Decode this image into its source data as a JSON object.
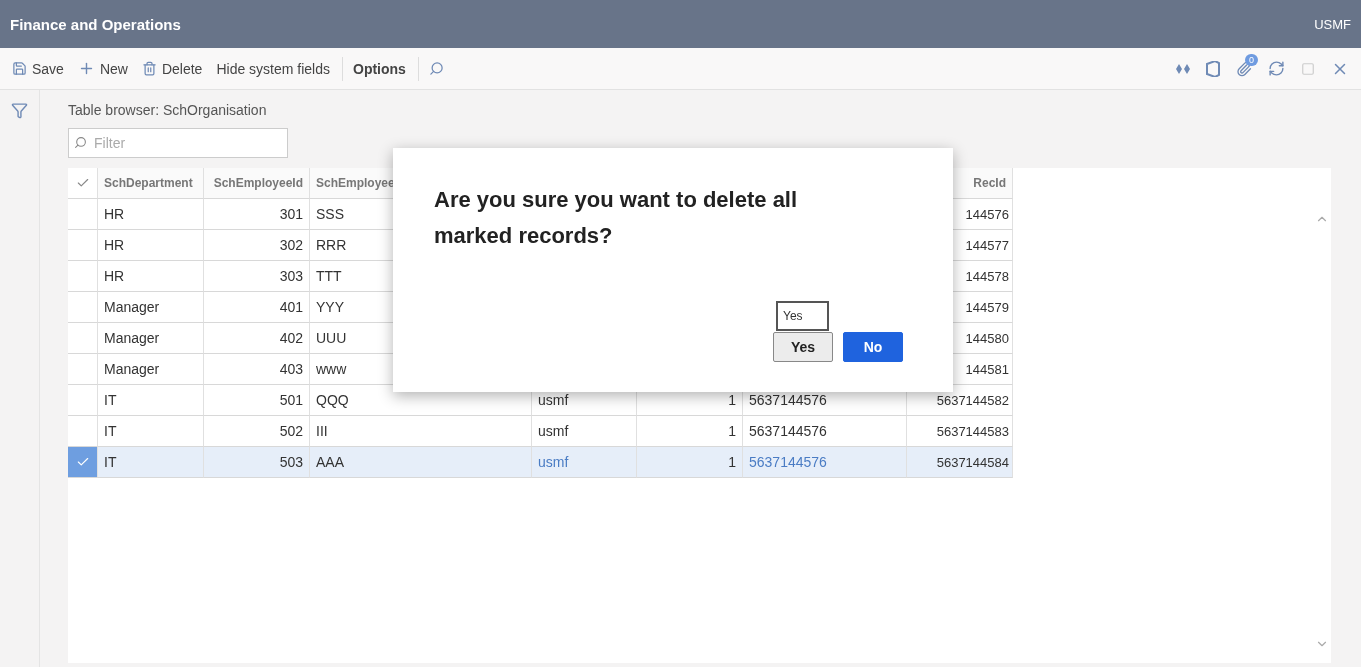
{
  "window": {
    "title": "Finance and Operations",
    "company": "USMF"
  },
  "toolbar": {
    "actions": [
      {
        "kind": "save",
        "label": "Save"
      },
      {
        "kind": "new",
        "label": "New"
      },
      {
        "kind": "delete",
        "label": "Delete"
      },
      {
        "kind": "plain",
        "label": "Hide system fields"
      },
      {
        "kind": "options",
        "label": "Options"
      },
      {
        "kind": "search"
      }
    ],
    "attachment_count": "0"
  },
  "page": {
    "caption": "Table browser: SchOrganisation",
    "filter": {
      "placeholder": "Filter"
    }
  },
  "table": {
    "select_all_checked": false,
    "columns": [
      "SchDepartment",
      "SchEmployeeId",
      "SchEmployee",
      "RecId"
    ],
    "rows": [
      {
        "selected": false,
        "department": "HR",
        "employee_id": "301",
        "employee_name": "SSS",
        "rec_id": "144576"
      },
      {
        "selected": false,
        "department": "HR",
        "employee_id": "302",
        "employee_name": "RRR",
        "rec_id": "144577"
      },
      {
        "selected": false,
        "department": "HR",
        "employee_id": "303",
        "employee_name": "TTT",
        "rec_id": "144578"
      },
      {
        "selected": false,
        "department": "Manager",
        "employee_id": "401",
        "employee_name": "YYY",
        "rec_id": "144579"
      },
      {
        "selected": false,
        "department": "Manager",
        "employee_id": "402",
        "employee_name": "UUU",
        "rec_id": "144580"
      },
      {
        "selected": false,
        "department": "Manager",
        "employee_id": "403",
        "employee_name": "www",
        "rec_id": "144581"
      },
      {
        "selected": false,
        "department": "IT",
        "employee_id": "501",
        "employee_name": "QQQ",
        "column_4": "usmf",
        "column_5": "1",
        "column_6": "5637144576",
        "rec_id": "5637144582"
      },
      {
        "selected": false,
        "department": "IT",
        "employee_id": "502",
        "employee_name": "III",
        "column_4": "usmf",
        "column_5": "1",
        "column_6": "5637144576",
        "rec_id": "5637144583"
      },
      {
        "selected": true,
        "department": "IT",
        "employee_id": "503",
        "employee_name": "AAA",
        "column_4": "usmf",
        "column_5": "1",
        "column_6": "5637144576",
        "rec_id": "5637144584"
      }
    ]
  },
  "dialog": {
    "message": "Are you sure you want to delete all marked records?",
    "tooltip": "Yes",
    "buttons": [
      {
        "label": "Yes",
        "kind": "secondary"
      },
      {
        "label": "No",
        "kind": "primary"
      }
    ]
  }
}
